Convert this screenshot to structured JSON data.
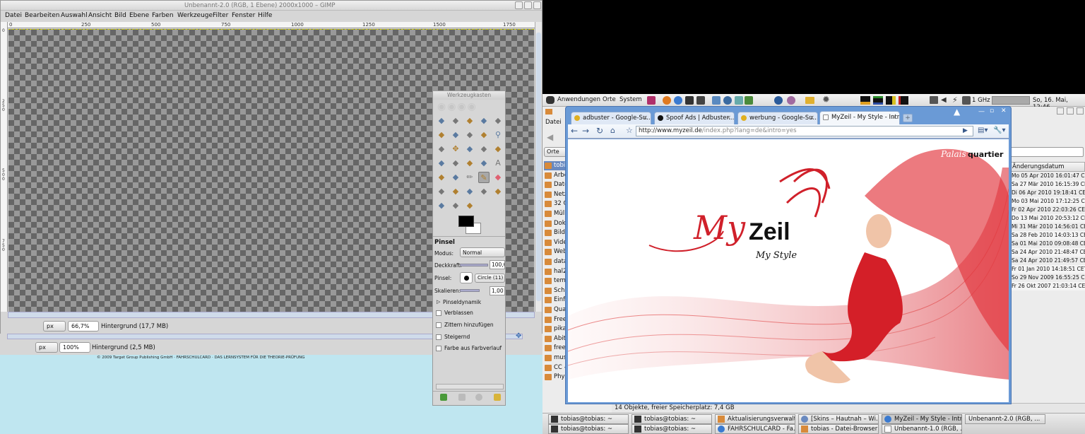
{
  "gimp": {
    "title": "Unbenannt-2.0 (RGB, 1 Ebene) 2000x1000 – GIMP",
    "menu": [
      "Datei",
      "Bearbeiten",
      "Auswahl",
      "Ansicht",
      "Bild",
      "Ebene",
      "Farben",
      "Werkzeuge",
      "Filter",
      "Fenster",
      "Hilfe"
    ],
    "ruler_ticks": [
      "0",
      "250",
      "500",
      "750",
      "1000",
      "1250",
      "1500",
      "1750"
    ],
    "vruler_ticks": [
      "0",
      "2\n5\n0",
      "5\n0\n0",
      "7\n5\n0"
    ],
    "unit": "px",
    "zoom": "66,7%",
    "layer_status": "Hintergrund (17,7 MB)"
  },
  "gimp2": {
    "unit": "px",
    "zoom": "100%",
    "layer_status": "Hintergrund (2,5 MB)",
    "footer_text": "© 2009 Target Group Publishing GmbH · FAHRSCHULCARD · DAS LERNSYSTEM FÜR DIE THEORIE-PRÜFUNG"
  },
  "toolbox": {
    "title": "Werkzeugkasten",
    "options_title": "Pinsel",
    "modus_label": "Modus:",
    "modus_value": "Normal",
    "deckkraft_label": "Deckkraft:",
    "deckkraft_value": "100,0",
    "pinsel_label": "Pinsel:",
    "pinsel_value": "Circle (11)",
    "skalieren_label": "Skalieren:",
    "skalieren_value": "1,00",
    "pinseldynamik": "Pinseldynamik",
    "opt_verblassen": "Verblassen",
    "opt_zittern": "Zittern hinzufügen",
    "opt_steigernd": "Steigernd",
    "opt_farbverlauf": "Farbe aus Farbverlauf"
  },
  "panel": {
    "menus": [
      "Anwendungen",
      "Orte",
      "System"
    ],
    "cpu": "1 GHz",
    "clock": "So, 16. Mai, 12:46"
  },
  "filebrowser": {
    "menu_datei": "Datei",
    "orte": "Orte",
    "places": [
      "tobias",
      "Arbeit",
      "Date",
      "Netzw",
      "32 GB",
      "Müll",
      "Doku",
      "Bilde",
      "Video",
      "Webs",
      "data",
      "hal20",
      "temp",
      "Schu",
      "Einfu",
      "Quali",
      "Freeh",
      "pika",
      "Abitu",
      "freeh",
      "musi",
      "CC -",
      "Physi"
    ],
    "date_header": "Änderungsdatum",
    "dates": [
      "Mo 05 Apr 2010 16:01:47 CEST",
      "Sa 27 Mär 2010 16:15:39 CET",
      "Di 06 Apr 2010 19:18:41 CEST",
      "Mo 03 Mai 2010 17:12:25 CEST",
      "Fr 02 Apr 2010 22:03:26 CEST",
      "Do 13 Mai 2010 20:53:12 CEST",
      "Mi 31 Mär 2010 14:56:01 CEST",
      "Sa 28 Feb 2010 14:03:13 CET",
      "Sa 01 Mai 2010 09:08:48 CEST",
      "Sa 24 Apr 2010 21:48:47 CEST",
      "Sa 24 Apr 2010 21:49:57 CEST",
      "Fr 01 Jan 2010 14:18:51 CET",
      "So 29 Nov 2009 16:55:25 CET",
      "Fr 26 Okt 2007 21:03:14 CEST"
    ],
    "status": "14 Objekte, freier Speicherplatz: 7,4 GB"
  },
  "browser": {
    "tabs": [
      {
        "label": "adbuster - Google-Su...",
        "color": "#e0b020"
      },
      {
        "label": "Spoof Ads | Adbuster...",
        "color": "#111111"
      },
      {
        "label": "werbung - Google-Su...",
        "color": "#e0b020"
      },
      {
        "label": "MyZeil - My Style - Intro",
        "color": "#ffffff"
      }
    ],
    "url_host": "http://www.myzeil.de",
    "url_path": "/index.php?lang=de&intro=yes",
    "brand_my": "My",
    "brand_zeil": "Zeil",
    "brand_style": "My Style",
    "palais": "Palais",
    "quartier": "quartier"
  },
  "taskbar": {
    "row1": [
      "tobias@tobias: ~",
      "tobias@tobias: ~",
      "Aktualisierungsverwalt...",
      "[Skins – Hautnah – Wi...",
      "MyZeil - My Style - Intr...",
      "Unbenannt-2.0 (RGB, ..."
    ],
    "row2": [
      "tobias@tobias: ~",
      "tobias@tobias: ~",
      "FAHRSCHULCARD - Fa...",
      "tobias - Datei-Browser",
      "Unbenannt-1.0 (RGB, ..."
    ]
  },
  "colors": {
    "accent_red": "#d0202a",
    "gimp_bg": "#d6d6d6",
    "desktop_cyan": "#bfe6f0",
    "browser_frame": "#6a9ad6"
  }
}
